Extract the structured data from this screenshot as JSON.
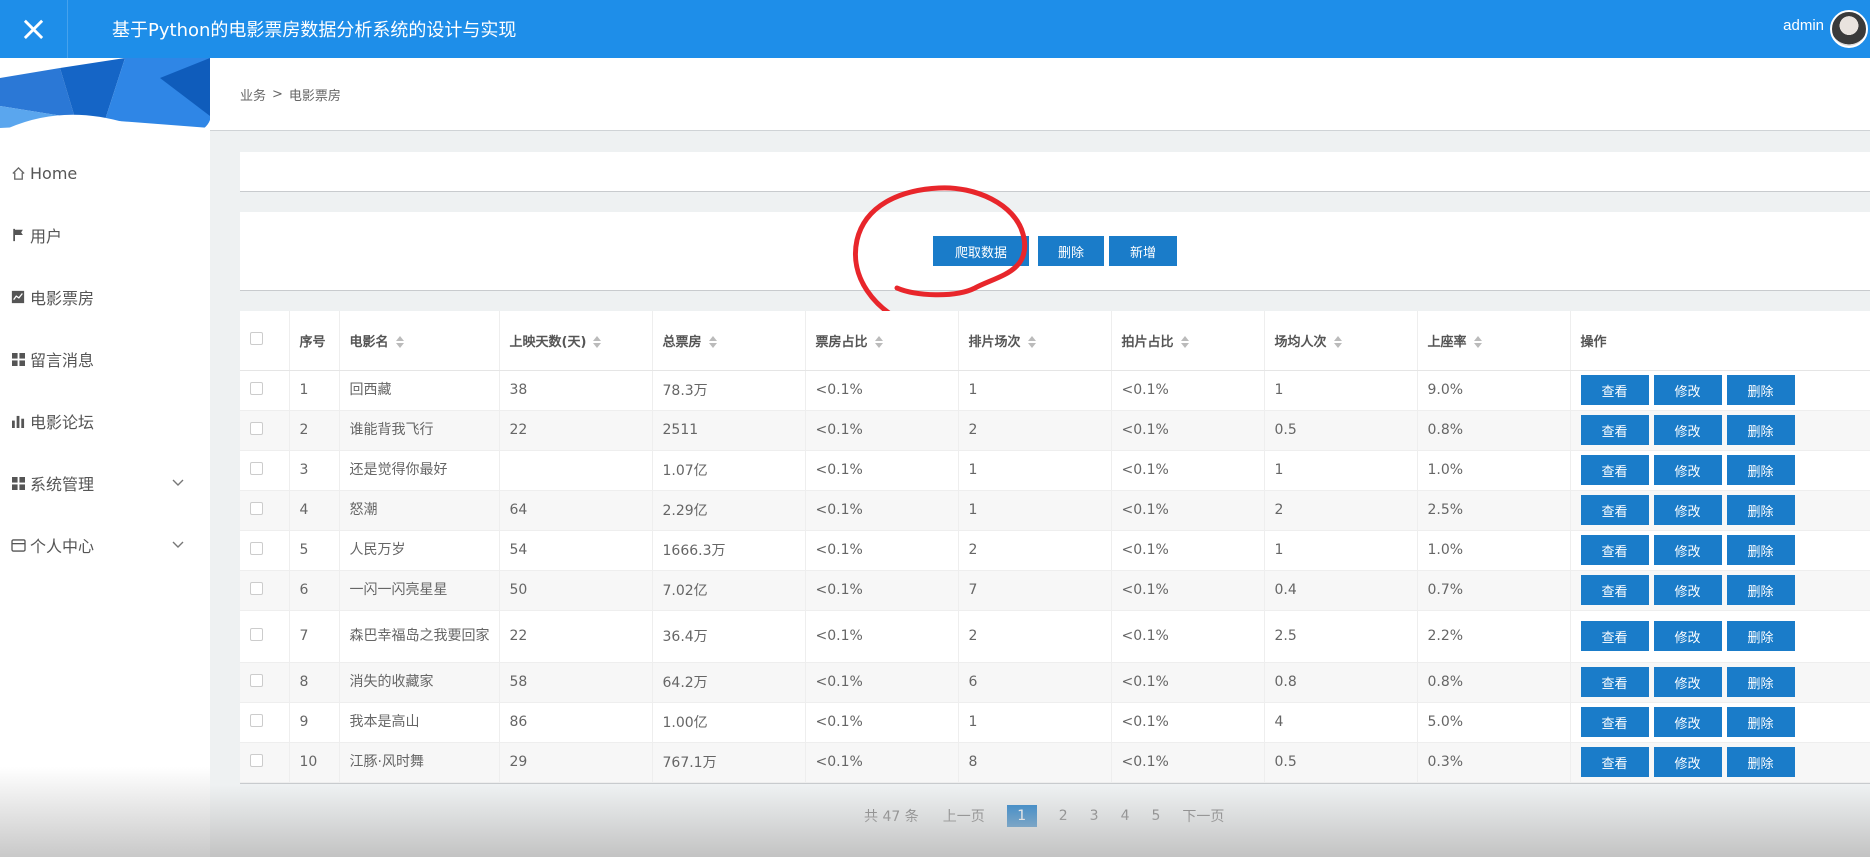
{
  "header": {
    "title": "基于Python的电影票房数据分析系统的设计与实现",
    "close_icon": "×",
    "user": "admin"
  },
  "breadcrumb": {
    "level1": "业务",
    "separator": ">",
    "level2": "电影票房"
  },
  "sidebar": {
    "items": [
      {
        "label": "Home",
        "icon": "home-icon"
      },
      {
        "label": "用户",
        "icon": "flag-icon"
      },
      {
        "label": "电影票房",
        "icon": "line-chart-icon"
      },
      {
        "label": "留言消息",
        "icon": "grid-icon"
      },
      {
        "label": "电影论坛",
        "icon": "bar-chart-icon"
      },
      {
        "label": "系统管理",
        "icon": "grid-icon",
        "expandable": true
      },
      {
        "label": "个人中心",
        "icon": "card-icon",
        "expandable": true
      }
    ]
  },
  "actions": {
    "crawl": "爬取数据",
    "delete": "删除",
    "add": "新增"
  },
  "table": {
    "headers": [
      "序号",
      "电影名",
      "上映天数(天)",
      "总票房",
      "票房占比",
      "排片场次",
      "拍片占比",
      "场均人次",
      "上座率",
      "操作"
    ],
    "op_labels": {
      "view": "查看",
      "edit": "修改",
      "delete": "删除"
    },
    "rows": [
      [
        "1",
        "回西藏",
        "38",
        "78.3万",
        "<0.1%",
        "1",
        "<0.1%",
        "1",
        "9.0%"
      ],
      [
        "2",
        "谁能背我飞行",
        "22",
        "2511",
        "<0.1%",
        "2",
        "<0.1%",
        "0.5",
        "0.8%"
      ],
      [
        "3",
        "还是觉得你最好",
        "",
        "1.07亿",
        "<0.1%",
        "1",
        "<0.1%",
        "1",
        "1.0%"
      ],
      [
        "4",
        "怒潮",
        "64",
        "2.29亿",
        "<0.1%",
        "1",
        "<0.1%",
        "2",
        "2.5%"
      ],
      [
        "5",
        "人民万岁",
        "54",
        "1666.3万",
        "<0.1%",
        "2",
        "<0.1%",
        "1",
        "1.0%"
      ],
      [
        "6",
        "一闪一闪亮星星",
        "50",
        "7.02亿",
        "<0.1%",
        "7",
        "<0.1%",
        "0.4",
        "0.7%"
      ],
      [
        "7",
        "森巴幸福岛之我要回家",
        "22",
        "36.4万",
        "<0.1%",
        "2",
        "<0.1%",
        "2.5",
        "2.2%"
      ],
      [
        "8",
        "消失的收藏家",
        "58",
        "64.2万",
        "<0.1%",
        "6",
        "<0.1%",
        "0.8",
        "0.8%"
      ],
      [
        "9",
        "我本是高山",
        "86",
        "1.00亿",
        "<0.1%",
        "1",
        "<0.1%",
        "4",
        "5.0%"
      ],
      [
        "10",
        "江豚·风时舞",
        "29",
        "767.1万",
        "<0.1%",
        "8",
        "<0.1%",
        "0.5",
        "0.3%"
      ]
    ]
  },
  "pagination": {
    "total": "共 47 条",
    "prev": "上一页",
    "pages": [
      "1",
      "2",
      "3",
      "4",
      "5"
    ],
    "current": "1",
    "next": "下一页"
  },
  "colors": {
    "primary": "#1e8ee9",
    "button": "#1a7cc9",
    "annotation": "#e8262b"
  }
}
